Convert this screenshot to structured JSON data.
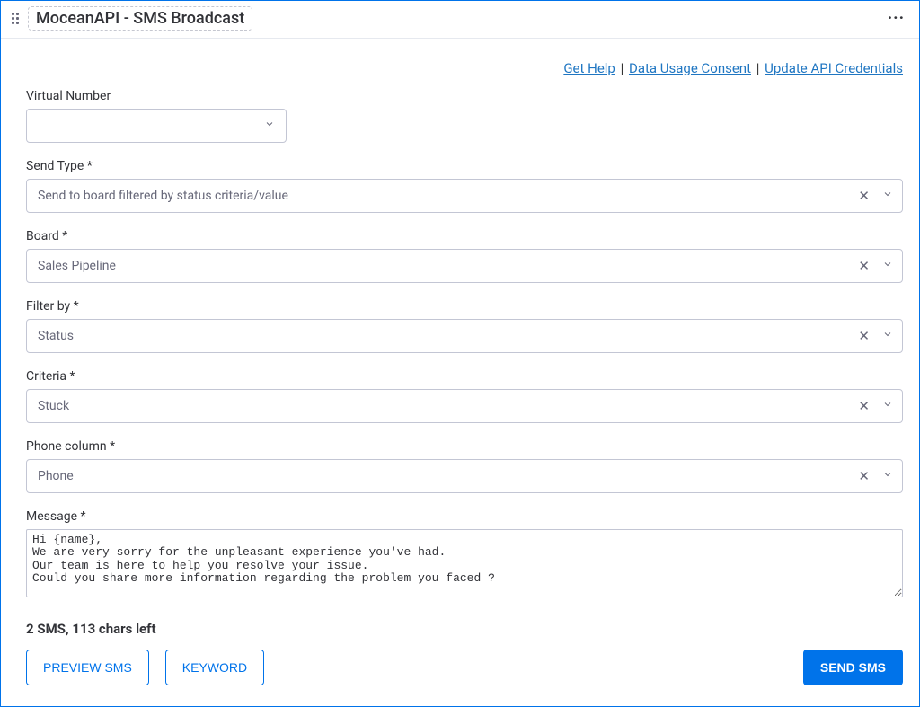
{
  "header": {
    "title": "MoceanAPI - SMS Broadcast"
  },
  "links": {
    "get_help": "Get Help",
    "data_usage": "Data Usage Consent",
    "update_api": "Update API Credentials"
  },
  "fields": {
    "virtual_number": {
      "label": "Virtual Number",
      "value": ""
    },
    "send_type": {
      "label": "Send Type *",
      "value": "Send to board filtered by status criteria/value"
    },
    "board": {
      "label": "Board *",
      "value": "Sales Pipeline"
    },
    "filter_by": {
      "label": "Filter by *",
      "value": "Status"
    },
    "criteria": {
      "label": "Criteria *",
      "value": "Stuck"
    },
    "phone_column": {
      "label": "Phone column *",
      "value": "Phone"
    },
    "message": {
      "label": "Message *",
      "value": "Hi {name},\nWe are very sorry for the unpleasant experience you've had.\nOur team is here to help you resolve your issue.\nCould you share more information regarding the problem you faced ?"
    }
  },
  "counter": "2 SMS, 113 chars left",
  "buttons": {
    "preview": "PREVIEW SMS",
    "keyword": "KEYWORD",
    "send": "SEND SMS"
  }
}
